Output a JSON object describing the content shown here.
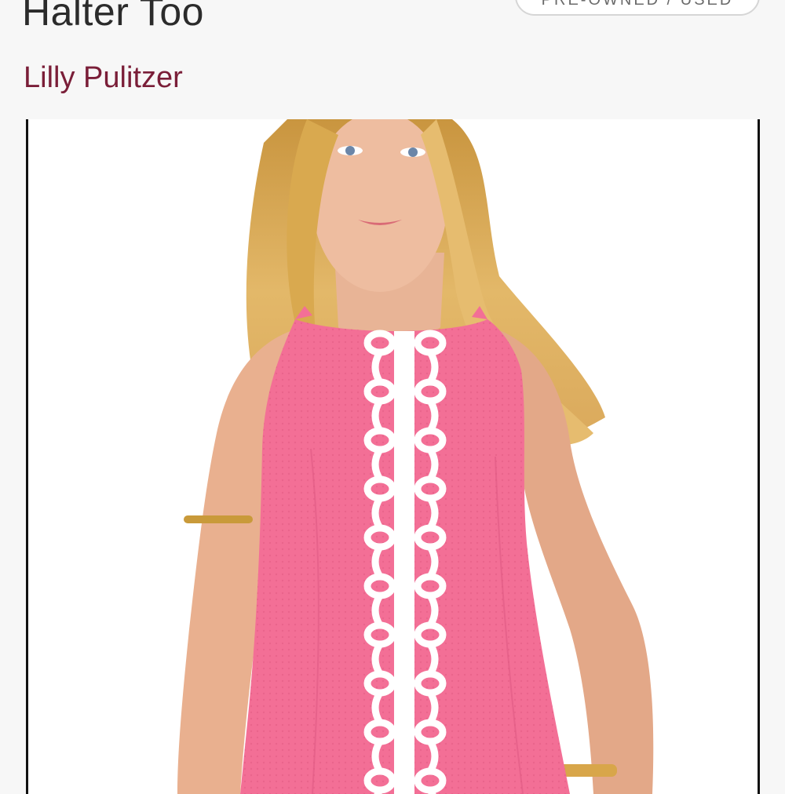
{
  "listing": {
    "title": "Halter Too",
    "brand": "Lilly Pulitzer",
    "condition_chip": "PRE-OWNED / USED"
  },
  "colors": {
    "title": "#2b2b2b",
    "brand": "#7a1e38",
    "dress": "#f36f96",
    "lace": "#ffffff",
    "background": "#f7f7f7"
  },
  "photo": {
    "description_icon": "product-photo"
  }
}
